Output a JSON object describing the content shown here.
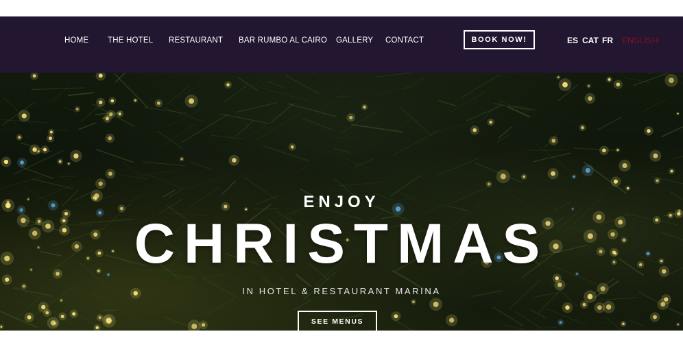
{
  "nav": {
    "items": [
      {
        "label": "HOME"
      },
      {
        "label": "THE HOTEL"
      },
      {
        "label": "RESTAURANT"
      },
      {
        "label": "BAR RUMBO AL CAIRO"
      },
      {
        "label": "GALLERY"
      },
      {
        "label": "CONTACT"
      }
    ],
    "book_label": "BOOK NOW!",
    "languages": [
      {
        "label": "ES",
        "active": false
      },
      {
        "label": "CAT",
        "active": false
      },
      {
        "label": "FR",
        "active": false
      },
      {
        "label": "ENGLISH",
        "active": true
      }
    ]
  },
  "hero": {
    "kicker": "ENJOY",
    "title": "CHRISTMAS",
    "subtitle": "IN HOTEL & RESTAURANT MARINA",
    "button_label": "SEE MENUS"
  },
  "colors": {
    "navbar_bg": "#221631",
    "active_language": "#8a1020",
    "light_glow": "#f4e27a",
    "light_blue": "#6ab8f0"
  }
}
